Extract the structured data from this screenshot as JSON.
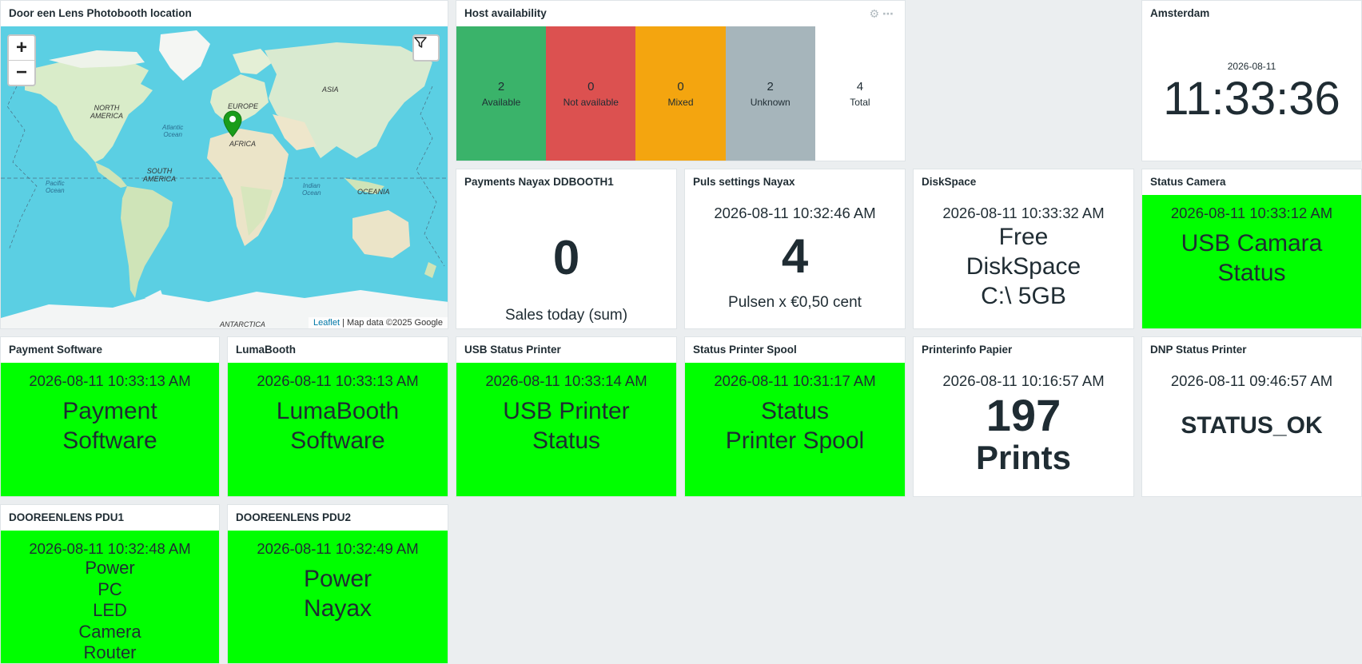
{
  "map": {
    "title": "Door een Lens Photobooth location",
    "zoom_in": "+",
    "zoom_out": "−",
    "attribution_link": "Leaflet",
    "attribution_rest": " | Map data ©2025 Google",
    "labels": {
      "north_america": "NORTH\nAMERICA",
      "south_america": "SOUTH\nAMERICA",
      "europe": "EUROPE",
      "africa": "AFRICA",
      "asia": "ASIA",
      "oceania": "OCEANIA",
      "antarctica": "ANTARCTICA",
      "atlantic": "Atlantic\nOcean",
      "pacific": "Pacific\nOcean",
      "indian": "Indian\nOcean"
    }
  },
  "host_availability": {
    "title": "Host availability",
    "cells": [
      {
        "count": "2",
        "label": "Available",
        "color": "#3ab36a"
      },
      {
        "count": "0",
        "label": "Not available",
        "color": "#dc5150"
      },
      {
        "count": "0",
        "label": "Mixed",
        "color": "#f4a50f"
      },
      {
        "count": "2",
        "label": "Unknown",
        "color": "#a6b5bb"
      },
      {
        "count": "4",
        "label": "Total",
        "color": "#ffffff"
      }
    ]
  },
  "clock": {
    "title": "Amsterdam",
    "date": "2026-08-11",
    "time": "11:33:36"
  },
  "payments": {
    "title": "Payments Nayax DDBOOTH1",
    "value": "0",
    "caption": "Sales today (sum)"
  },
  "puls": {
    "title": "Puls settings Nayax",
    "timestamp": "2026-08-11 10:32:46 AM",
    "value": "4",
    "caption": "Pulsen x €0,50 cent"
  },
  "disk": {
    "title": "DiskSpace",
    "timestamp": "2026-08-11 10:33:32 AM",
    "line1": "Free",
    "line2": "DiskSpace",
    "line3": "C:\\ 5GB"
  },
  "camera": {
    "title": "Status Camera",
    "timestamp": "2026-08-11 10:33:12 AM",
    "line1": "USB Camara",
    "line2": "Status"
  },
  "payment_software": {
    "title": "Payment Software",
    "timestamp": "2026-08-11 10:33:13 AM",
    "line1": "Payment",
    "line2": "Software"
  },
  "lumabooth": {
    "title": "LumaBooth",
    "timestamp": "2026-08-11 10:33:13 AM",
    "line1": "LumaBooth",
    "line2": "Software"
  },
  "usb_printer": {
    "title": "USB Status Printer",
    "timestamp": "2026-08-11 10:33:14 AM",
    "line1": "USB Printer",
    "line2": "Status"
  },
  "spool": {
    "title": "Status Printer Spool",
    "timestamp": "2026-08-11 10:31:17 AM",
    "line1": "Status",
    "line2": "Printer Spool"
  },
  "printerinfo": {
    "title": "Printerinfo Papier",
    "timestamp": "2026-08-11 10:16:57 AM",
    "value": "197",
    "caption": "Prints"
  },
  "dnp": {
    "title": "DNP Status Printer",
    "timestamp": "2026-08-11 09:46:57 AM",
    "status": "STATUS_OK"
  },
  "pdu1": {
    "title": "DOOREENLENS PDU1",
    "timestamp": "2026-08-11 10:32:48 AM",
    "lines": [
      "Power",
      "PC",
      "LED",
      "Camera",
      "Router"
    ]
  },
  "pdu2": {
    "title": "DOOREENLENS PDU2",
    "timestamp": "2026-08-11 10:32:49 AM",
    "line1": "Power",
    "line2": "Nayax"
  }
}
